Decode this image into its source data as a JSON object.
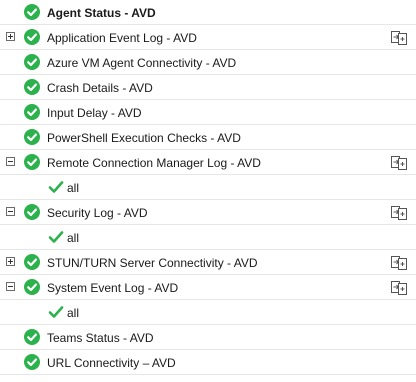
{
  "colors": {
    "ok": "#2bb24c",
    "divider": "#e6e6e6"
  },
  "header": {
    "label": "Agent Status - AVD",
    "status_icon": "check-circle-icon"
  },
  "rows": [
    {
      "label": "Application Event Log - AVD",
      "expander": "plus",
      "action_icon": "export-icon"
    },
    {
      "label": "Azure VM Agent Connectivity - AVD"
    },
    {
      "label": "Crash Details - AVD"
    },
    {
      "label": "Input Delay - AVD"
    },
    {
      "label": "PowerShell Execution Checks - AVD"
    },
    {
      "label": "Remote Connection Manager Log - AVD",
      "expander": "minus",
      "action_icon": "export-icon"
    },
    {
      "label": "all",
      "child": true
    },
    {
      "label": "Security Log - AVD",
      "expander": "minus",
      "action_icon": "export-icon"
    },
    {
      "label": "all",
      "child": true
    },
    {
      "label": "STUN/TURN Server Connectivity - AVD",
      "expander": "plus",
      "action_icon": "export-icon"
    },
    {
      "label": "System Event Log - AVD",
      "expander": "minus",
      "action_icon": "export-icon"
    },
    {
      "label": "all",
      "child": true
    },
    {
      "label": "Teams Status - AVD"
    },
    {
      "label": "URL Connectivity – AVD"
    }
  ]
}
